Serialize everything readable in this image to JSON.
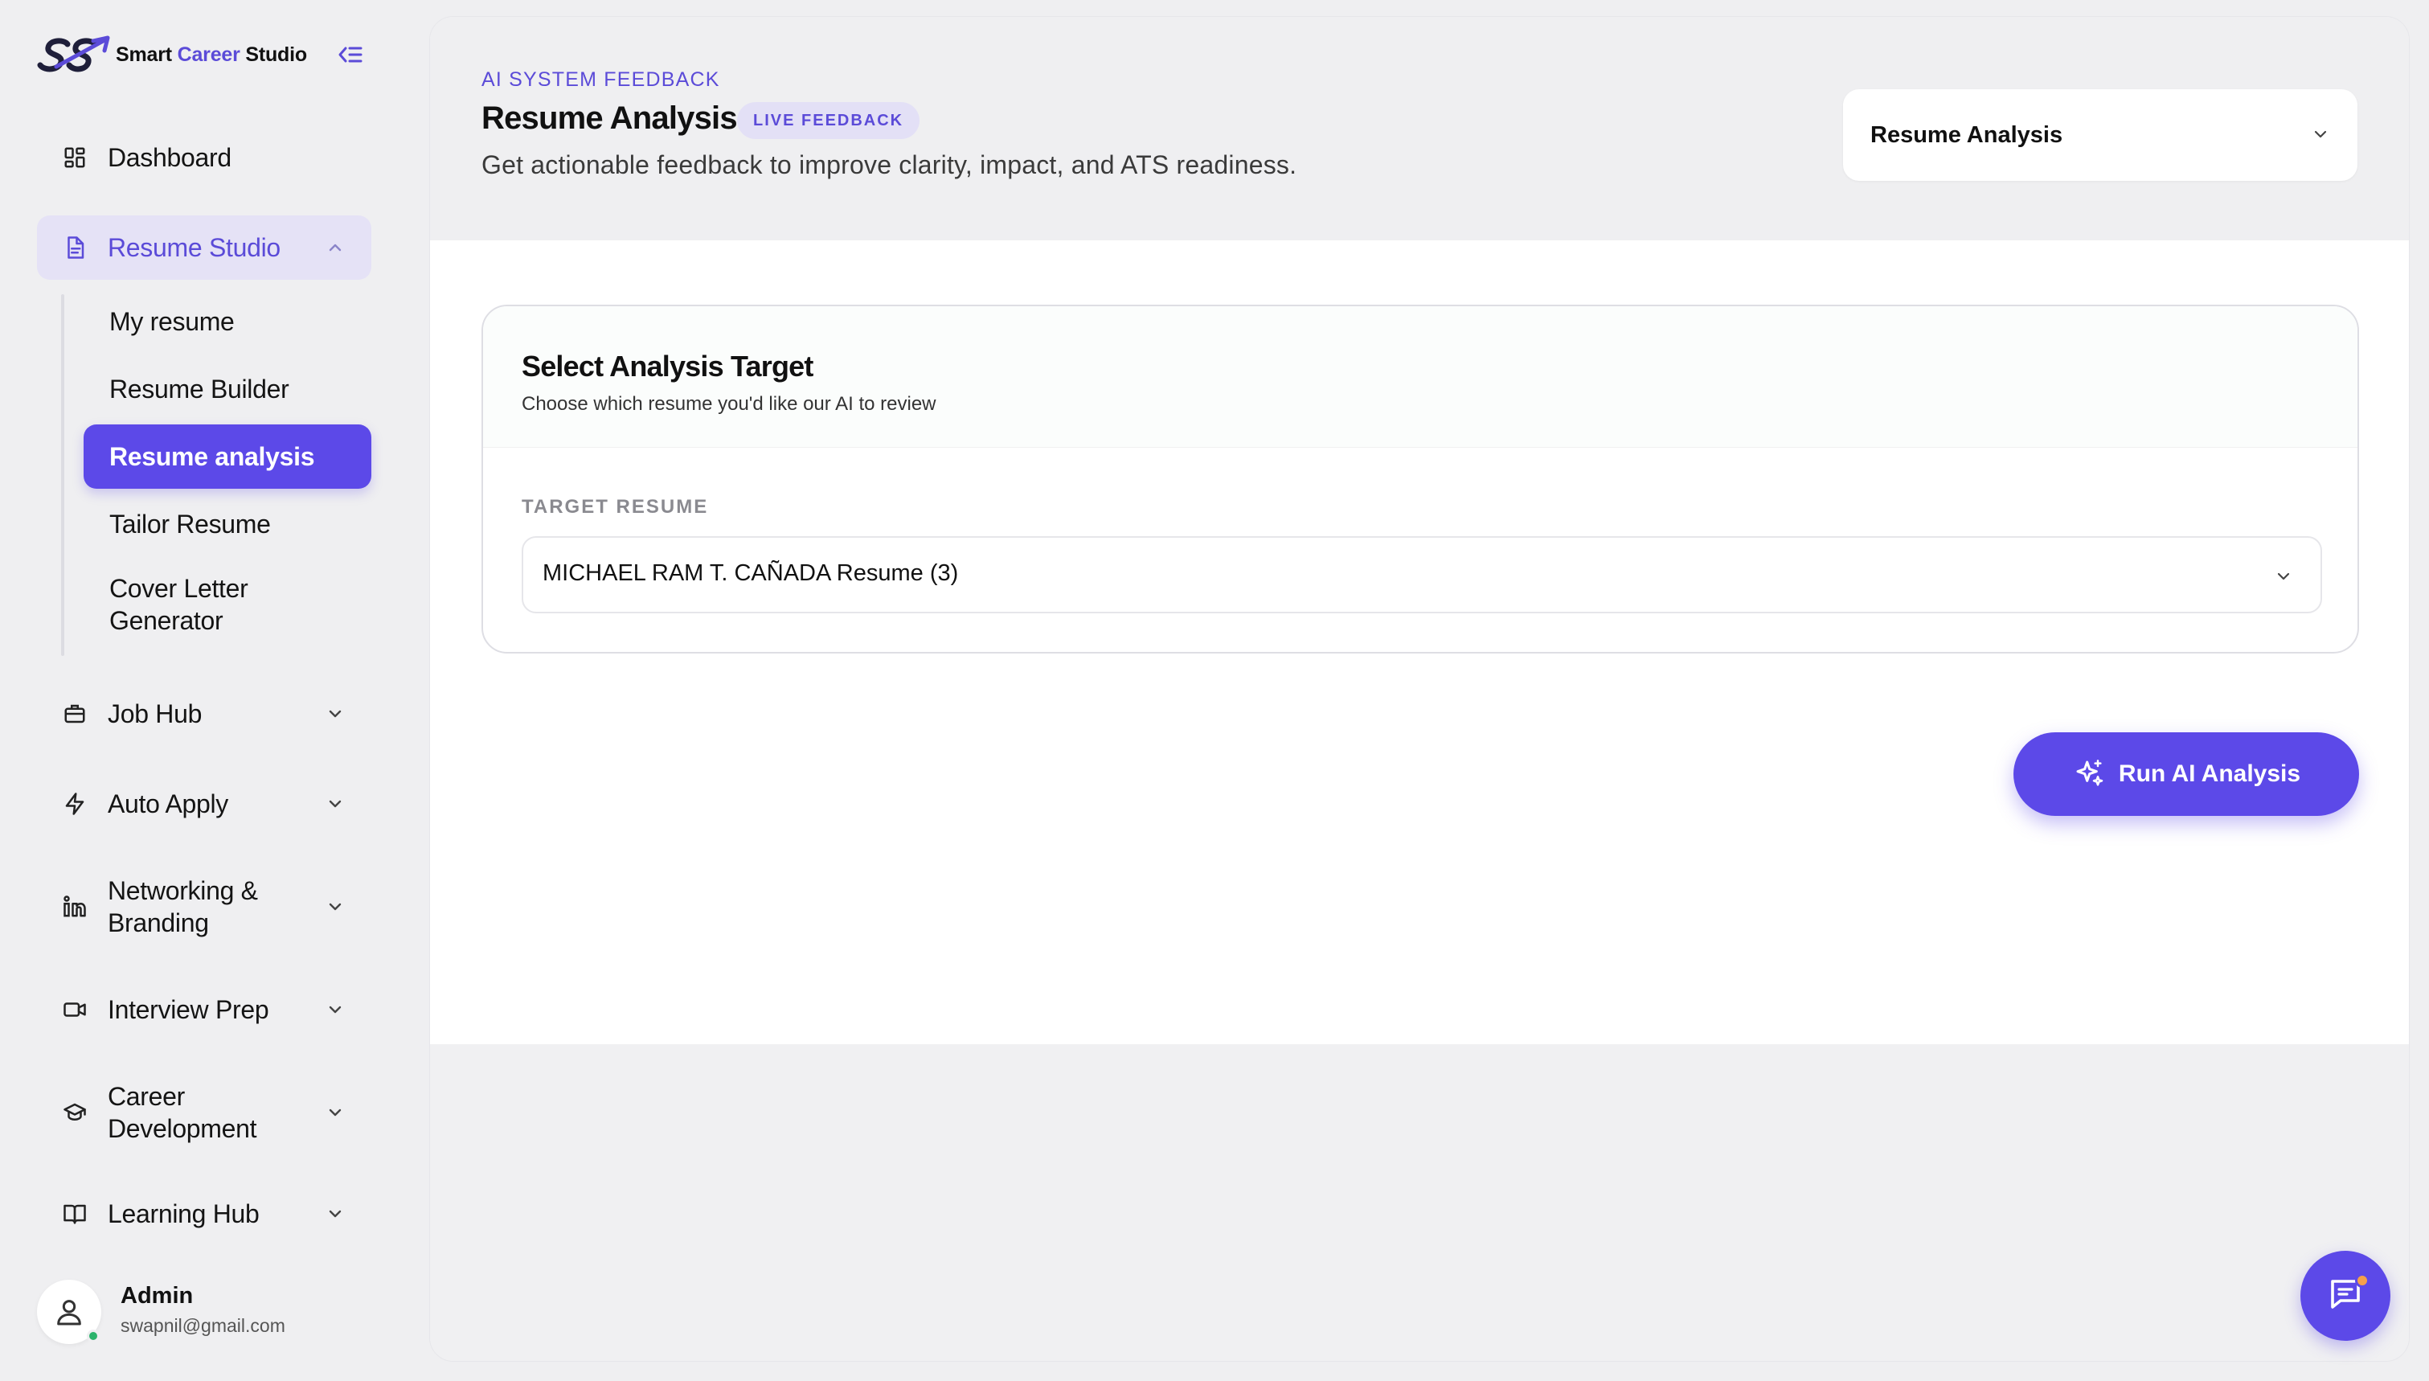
{
  "brand": {
    "name_part1": "Smart ",
    "name_accent": "Career",
    "name_part2": " Studio",
    "accent_color": "#5b4bd8",
    "logo_icon": "sss-logo-icon"
  },
  "sidebar": {
    "collapse_icon": "collapse-sidebar-icon",
    "items": [
      {
        "label": "Dashboard",
        "icon": "grid-icon"
      },
      {
        "label": "Resume Studio",
        "icon": "document-icon",
        "expanded": true,
        "active": true
      },
      {
        "label": "Job Hub",
        "icon": "briefcase-icon"
      },
      {
        "label": "Auto Apply",
        "icon": "bolt-icon"
      },
      {
        "label": "Networking & Branding",
        "icon": "linkedin-icon"
      },
      {
        "label": "Interview Prep",
        "icon": "video-icon"
      },
      {
        "label": "Career Development",
        "icon": "graduation-cap-icon"
      },
      {
        "label": "Learning Hub",
        "icon": "book-icon"
      }
    ],
    "resume_subitems": [
      {
        "label": "My resume"
      },
      {
        "label": "Resume Builder"
      },
      {
        "label": "Resume analysis",
        "active": true
      },
      {
        "label": "Tailor Resume"
      },
      {
        "label": "Cover Letter Generator"
      }
    ]
  },
  "user": {
    "name": "Admin",
    "email": "swapnil@gmail.com",
    "status_color": "#2bb36b"
  },
  "header": {
    "eyebrow": "AI SYSTEM FEEDBACK",
    "title": "Resume Analysis",
    "badge": "LIVE FEEDBACK",
    "subtitle": "Get actionable feedback to improve clarity, impact, and ATS readiness.",
    "view_select_value": "Resume Analysis"
  },
  "card": {
    "title": "Select Analysis Target",
    "subtitle": "Choose which resume you'd like our AI to review",
    "field_label": "TARGET RESUME",
    "selected_resume": "MICHAEL RAM T. CAÑADA Resume (3)"
  },
  "actions": {
    "run_label": "Run AI Analysis",
    "run_icon": "sparkles-icon",
    "chat_icon": "chat-icon",
    "primary_color": "#5c49e8"
  }
}
